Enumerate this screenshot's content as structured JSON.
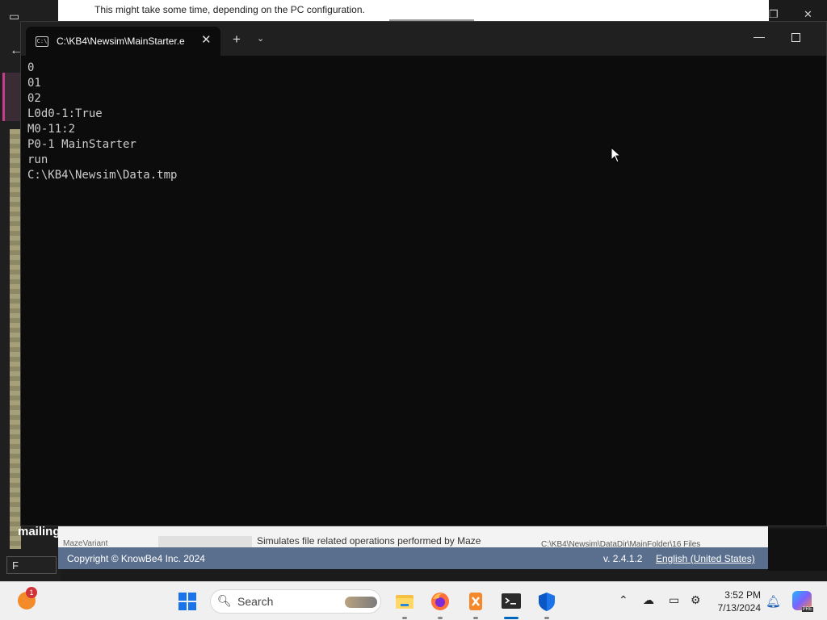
{
  "background": {
    "dialog_notice": "This might take some time, depending on the PC configuration.",
    "left_word": "mailing",
    "left_field_value": "F"
  },
  "terminal": {
    "tab_title": "C:\\KB4\\Newsim\\MainStarter.e",
    "new_tab_symbol": "+",
    "output_lines": [
      "0",
      "01",
      "02",
      "L0d0-1:True",
      "M0-11:2",
      "P0-1 MainStarter",
      "run",
      "C:\\KB4\\Newsim\\Data.tmp"
    ]
  },
  "bottom_dialog": {
    "list_row_name": "MazeVariant",
    "description": "Simulates file related operations performed by Maze",
    "path": "C:\\KB4\\Newsim\\DataDir\\MainFolder\\16 Files",
    "copyright": "Copyright © KnowBe4 Inc. 2024",
    "version": "v. 2.4.1.2",
    "language": "English (United States)"
  },
  "taskbar": {
    "notification_count": "1",
    "search_label": "Search",
    "clock_time": "3:52 PM",
    "clock_date": "7/13/2024",
    "copilot_badge": "PRE",
    "accent_color": "#0067c0"
  }
}
